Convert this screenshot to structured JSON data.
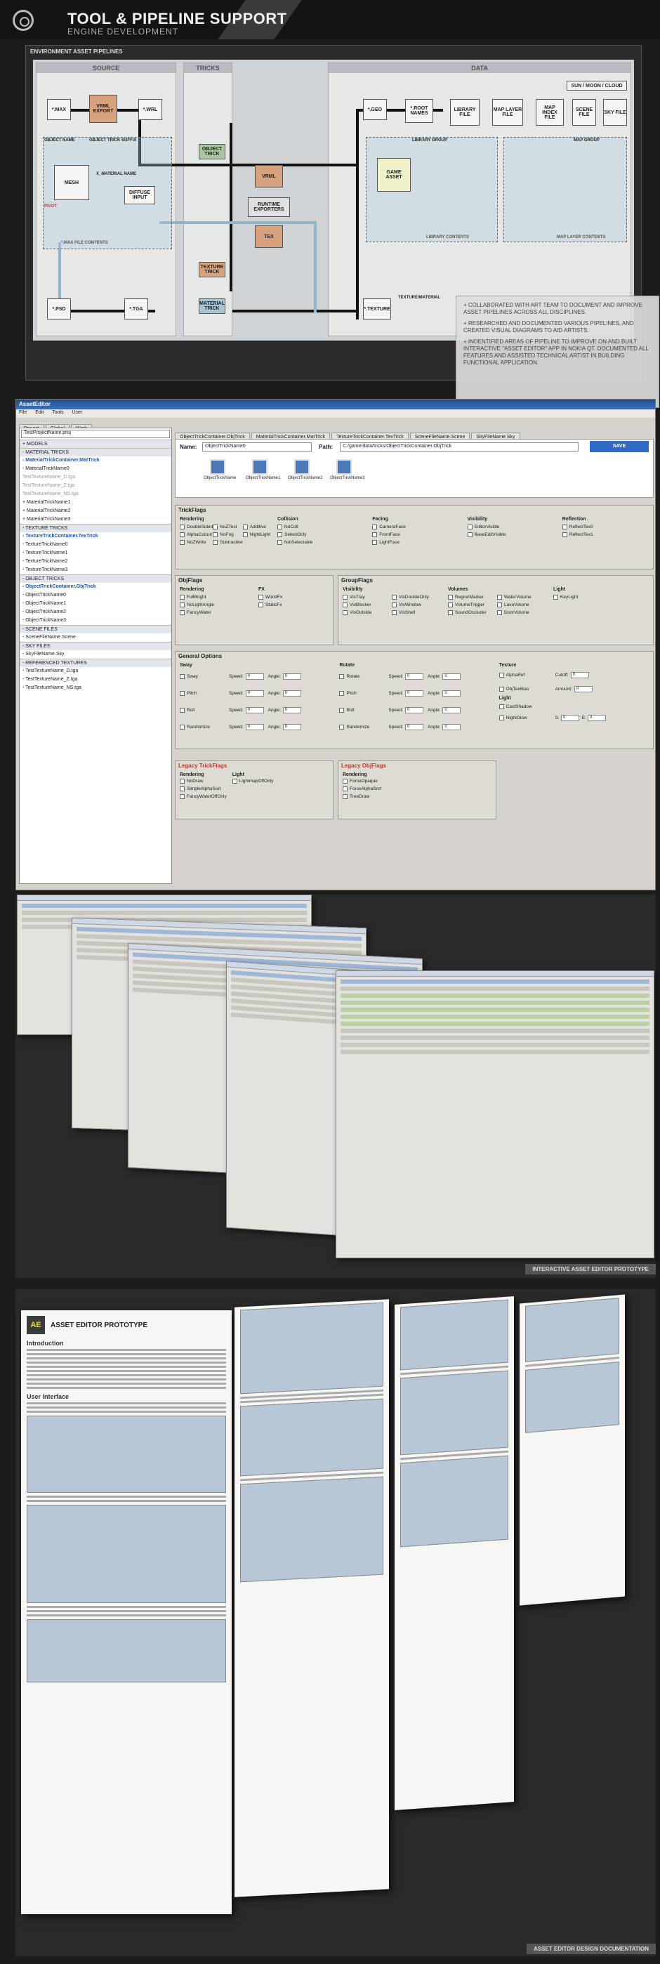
{
  "header": {
    "title": "TOOL & PIPELINE SUPPORT",
    "subtitle": "ENGINE DEVELOPMENT"
  },
  "pipeline": {
    "label": "ENVIRONMENT ASSET PIPELINES",
    "columns": {
      "source": "SOURCE",
      "tricks": "TRICKS",
      "data": "DATA"
    },
    "nodes": {
      "max": "*.MAX",
      "vrml_export": "VRML EXPORT",
      "wrl": "*.WRL",
      "object_trick": "OBJECT TRICK",
      "vrml": "VRML",
      "runtime_exporters": "RUNTIME EXPORTERS",
      "tex": "TEX",
      "texture_trick": "TEXTURE TRICK",
      "material_trick": "MATERIAL TRICK",
      "psd": "*.PSD",
      "tga": "*.TGA",
      "geo": "*.GEO",
      "root_names": "*.ROOT NAMES",
      "library_file": "LIBRARY FILE",
      "map_layer_file": "MAP LAYER FILE",
      "map_index_file": "MAP INDEX FILE",
      "scene_file": "SCENE FILE",
      "sky_file": "SKY FILE",
      "texture": "*.TEXTURE",
      "mesh": "MESH",
      "pivot": "PIVOT",
      "diffuse_input": "DIFFUSE INPUT",
      "game_asset": "GAME ASSET",
      "sun_moon_cloud": "SUN / MOON / CLOUD"
    },
    "labels": {
      "object_name": "OBJECT NAME",
      "object_trick_suffix": "OBJECT TRICK SUFFIX",
      "x_material_name": "X_MATERIAL NAME",
      "max_file_contents": "*.MAX FILE CONTENTS",
      "library_group": "LIBRARY GROUP",
      "map_group": "MAP GROUP",
      "library_contents": "LIBRARY CONTENTS",
      "map_layer_contents": "MAP LAYER CONTENTS",
      "texture_material": "TEXTURE/MATERIAL"
    },
    "notes": [
      "+ COLLABORATED WITH ART TEAM TO DOCUMENT AND IMPROVE ASSET PIPELINES ACROSS ALL DISCIPLINES.",
      "+ RESEARCHED AND DOCUMENTED VARIOUS PIPELINES, AND CREATED VISUAL DIAGRAMS TO AID ARTISTS.",
      "+ INDENTIFIED AREAS OF PIPELINE TO IMPROVE ON AND BUILT INTERACTIVE \"ASSET EDITOR\" APP IN NOKIA QT. DOCUMENTED ALL FEATURES AND ASSISTED TECHNICAL ARTIST IN BUILDING FUNCTIONAL APPLICATION."
    ]
  },
  "app": {
    "title": "AssetEditor",
    "menu": [
      "File",
      "Edit",
      "Tools",
      "User"
    ],
    "left_tabs": [
      "Project",
      "Global",
      "Work"
    ],
    "project_select": "TestProjectName.proj",
    "tree": [
      {
        "t": "+ MODELS",
        "c": "cat"
      },
      {
        "t": "- MATERIAL TRICKS",
        "c": "cat"
      },
      {
        "t": "- MaterialTrickContainer.MatTrick",
        "c": "sel"
      },
      {
        "t": "- MaterialTrickName0",
        "c": ""
      },
      {
        "t": "TestTextureName_D.tga",
        "c": "grey"
      },
      {
        "t": "TestTextureName_Z.tga",
        "c": "grey"
      },
      {
        "t": "TestTextureName_NS.tga",
        "c": "grey"
      },
      {
        "t": "+ MaterialTrickName1",
        "c": ""
      },
      {
        "t": "+ MaterialTrickName2",
        "c": ""
      },
      {
        "t": "+ MaterialTrickName3",
        "c": ""
      },
      {
        "t": "- TEXTURE TRICKS",
        "c": "cat"
      },
      {
        "t": "- TextureTrickContainer.TexTrick",
        "c": "sel"
      },
      {
        "t": "- TextureTrickName0",
        "c": ""
      },
      {
        "t": "- TextureTrickName1",
        "c": ""
      },
      {
        "t": "- TextureTrickName2",
        "c": ""
      },
      {
        "t": "- TextureTrickName3",
        "c": ""
      },
      {
        "t": "- OBJECT TRICKS",
        "c": "cat"
      },
      {
        "t": "- ObjectTrickContainer.ObjTrick",
        "c": "sel"
      },
      {
        "t": "- ObjectTrickName0",
        "c": ""
      },
      {
        "t": "- ObjectTrickName1",
        "c": ""
      },
      {
        "t": "- ObjectTrickName2",
        "c": ""
      },
      {
        "t": "- ObjectTrickName3",
        "c": ""
      },
      {
        "t": "- SCENE FILES",
        "c": "cat"
      },
      {
        "t": "- SceneFileName.Scene",
        "c": ""
      },
      {
        "t": "- SKY FILES",
        "c": "cat"
      },
      {
        "t": "- SkyFileName.Sky",
        "c": ""
      },
      {
        "t": "- REFERENCED TEXTURES",
        "c": "cat"
      },
      {
        "t": "- TestTextureName_D.tga",
        "c": ""
      },
      {
        "t": "- TestTextureName_Z.tga",
        "c": ""
      },
      {
        "t": "- TestTextureName_NS.tga",
        "c": ""
      }
    ],
    "doc_tabs": [
      "ObjectTrickContainer.ObjTrick",
      "MaterialTrickContainer.MatTrick",
      "TextureTrickContainer.TexTrick",
      "SceneFileName.Scene",
      "SkyFileName.Sky"
    ],
    "name_label": "Name:",
    "name_value": "ObjectTrickName0",
    "path_label": "Path:",
    "path_value": "C:/game/data/tricks/ObjectTrickContainer.ObjTrick",
    "save": "SAVE",
    "thumbs": [
      "ObjectTrickName",
      "ObjectTrickName1",
      "ObjectTrickName2",
      "ObjectTrickName3"
    ],
    "trickflags": {
      "title": "TrickFlags",
      "groups": [
        {
          "h": "Rendering",
          "items": [
            "DoubleSided",
            "AlphaCutout",
            "NoZWrite",
            "NoZTest",
            "NoFog",
            "Subtractive",
            "Additive",
            "NightLight"
          ]
        },
        {
          "h": "Collision",
          "items": [
            "NoColl",
            "SelectOnly",
            "NotSelectable"
          ]
        },
        {
          "h": "Facing",
          "items": [
            "CameraFace",
            "FrontFace",
            "LightFace"
          ]
        },
        {
          "h": "Visibility",
          "items": [
            "EditorVisible",
            "BaseEditVisible"
          ]
        },
        {
          "h": "Reflection",
          "items": [
            "ReflectTex0",
            "ReflectTex1"
          ]
        }
      ]
    },
    "objflags": {
      "title": "ObjFlags",
      "groups": [
        {
          "h": "Rendering",
          "items": [
            "FullBright",
            "NoLightAngle",
            "FancyWater"
          ]
        },
        {
          "h": "FX",
          "items": [
            "WorldFx",
            "StaticFx"
          ]
        }
      ]
    },
    "groupflags": {
      "title": "GroupFlags",
      "groups": [
        {
          "h": "Visibility",
          "items": [
            "VisTray",
            "VisBlocker",
            "VisOutside",
            "VisDoubleOnly",
            "VisWindow",
            "VisShell"
          ]
        },
        {
          "h": "Volumes",
          "items": [
            "RegionMarker",
            "VolumeTrigger",
            "SoundOccluder",
            "WaterVolume",
            "LavaVolume",
            "DoorVolume"
          ]
        },
        {
          "h": "Light",
          "items": [
            "KeyLight"
          ]
        }
      ]
    },
    "general": {
      "title": "General Options",
      "sway": {
        "h": "Sway",
        "rows": [
          "Sway",
          "Pitch",
          "Roll",
          "Randomize"
        ],
        "speed": "Speed:",
        "angle": "Angle:",
        "val": "0"
      },
      "rotate": {
        "h": "Rotate",
        "rows": [
          "Rotate",
          "Pitch",
          "Roll",
          "Randomize"
        ],
        "speed": "Speed:",
        "angle": "Angle:",
        "val": "0"
      },
      "texture": {
        "h": "Texture",
        "items": [
          "AlphaRef",
          "ObjTexBias"
        ],
        "cutoff": "Cutoff:",
        "amount": "Amount:",
        "val": "0"
      },
      "light": {
        "h": "Light",
        "items": [
          "CastShadow",
          "NightGlow"
        ],
        "s": "S:",
        "e": "E:",
        "val": "0"
      }
    },
    "legacy_trick": {
      "title": "Legacy TrickFlags",
      "rendering": "Rendering",
      "r_items": [
        "NoDraw",
        "SimpleAlphaSort",
        "FancyWaterOffOnly"
      ],
      "light": "Light",
      "l_items": [
        "LightmapOffOnly"
      ]
    },
    "legacy_obj": {
      "title": "Legacy ObjFlags",
      "rendering": "Rendering",
      "items": [
        "ForceOpaque",
        "ForceAlphaSort",
        "TreeDraw"
      ]
    }
  },
  "sections": {
    "prototype_tag": "INTERACTIVE ASSET EDITOR PROTOTYPE",
    "doc_tag": "ASSET EDITOR DESIGN DOCUMENTATION"
  },
  "doc": {
    "logo": "AE",
    "title": "ASSET EDITOR PROTOTYPE",
    "h_intro": "Introduction",
    "h_ui": "User Interface"
  },
  "colors": {
    "accent": "#2f6bc6",
    "bg": "#1c1c1c",
    "warn": "#c0392b"
  }
}
